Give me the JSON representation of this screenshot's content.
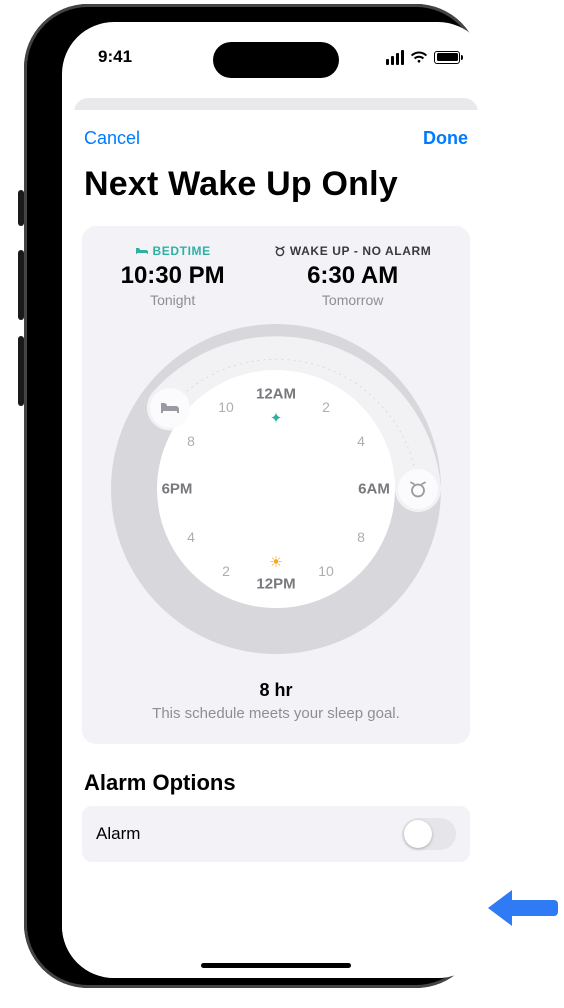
{
  "status": {
    "time": "9:41"
  },
  "nav": {
    "cancel": "Cancel",
    "done": "Done"
  },
  "title": "Next Wake Up Only",
  "bedtime": {
    "label": "BEDTIME",
    "time": "10:30 PM",
    "day": "Tonight"
  },
  "wakeup": {
    "label": "WAKE UP - NO ALARM",
    "time": "6:30 AM",
    "day": "Tomorrow"
  },
  "dial": {
    "top": "12AM",
    "bottom": "12PM",
    "left": "6PM",
    "right": "6AM",
    "h2a": "2",
    "h4a": "4",
    "h8a": "8",
    "h10a": "10",
    "h2b": "2",
    "h4b": "4",
    "h8b": "8",
    "h10b": "10"
  },
  "summary": {
    "duration": "8 hr",
    "message": "This schedule meets your sleep goal."
  },
  "section": {
    "title": "Alarm Options"
  },
  "alarm": {
    "label": "Alarm",
    "on": false
  }
}
